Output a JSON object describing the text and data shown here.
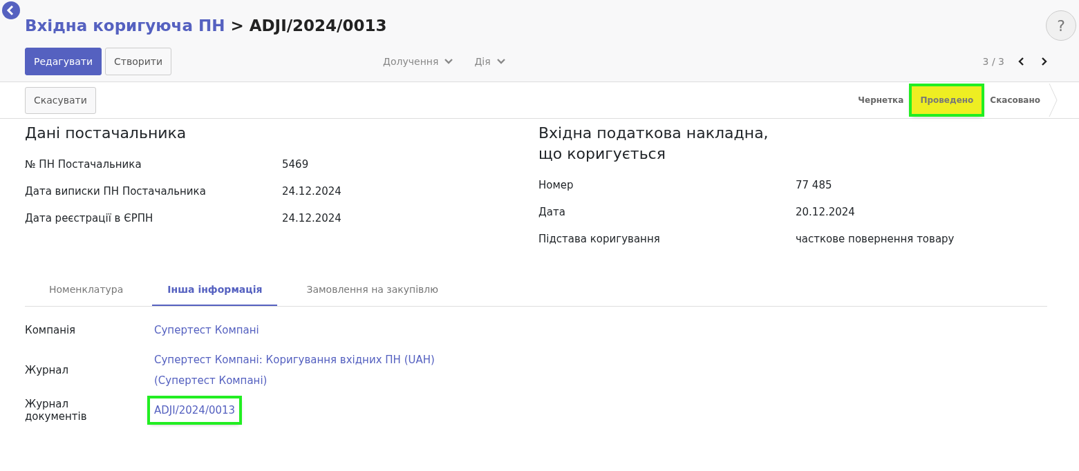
{
  "breadcrumb": {
    "parent": "Вхідна коригуюча ПН",
    "separator": ">",
    "current": "ADJI/2024/0013"
  },
  "help": {
    "label": "?"
  },
  "actions": [
    {
      "label": "Редагувати",
      "kind": "primary"
    },
    {
      "label": "Створити",
      "kind": "secondary"
    }
  ],
  "menus": [
    {
      "label": "Долучення"
    },
    {
      "label": "Дія"
    }
  ],
  "pager": {
    "text": "3 / 3"
  },
  "status_actions": [
    {
      "label": "Скасувати"
    }
  ],
  "statuses": [
    {
      "label": "Чернетка",
      "selected": false,
      "highlighted": false
    },
    {
      "label": "Проведено",
      "selected": true,
      "highlighted": true
    },
    {
      "label": "Скасовано",
      "selected": false,
      "highlighted": false
    }
  ],
  "groups": [
    {
      "title": "Дані постачальника",
      "fields": [
        {
          "label": "№ ПН Постачальника",
          "value": "5469"
        },
        {
          "label": "Дата виписки ПН Постачальника",
          "value": "24.12.2024"
        },
        {
          "label": "Дата реєстрації в ЄРПН",
          "value": "24.12.2024"
        }
      ]
    },
    {
      "title": "Вхідна податкова накладна, що коригується",
      "fields": [
        {
          "label": "Номер",
          "value": "77 485"
        },
        {
          "label": "Дата",
          "value": "20.12.2024"
        },
        {
          "label": "Підстава коригування",
          "value": "часткове повернення товару"
        }
      ]
    }
  ],
  "tabs": [
    {
      "label": "Номенклатура",
      "selected": false
    },
    {
      "label": "Інша інформація",
      "selected": true
    },
    {
      "label": "Замовлення на закупівлю",
      "selected": false
    }
  ],
  "tab_fields": [
    {
      "label": "Компанія",
      "value": "Супертест Компані",
      "highlighted": false
    },
    {
      "label": "Журнал",
      "value": "Супертест Компані: Коригування вхідних ПН (UAH) (Супертест Компані)",
      "highlighted": false
    },
    {
      "label": "Журнал документів",
      "value": "ADJI/2024/0013",
      "highlighted": true
    }
  ]
}
